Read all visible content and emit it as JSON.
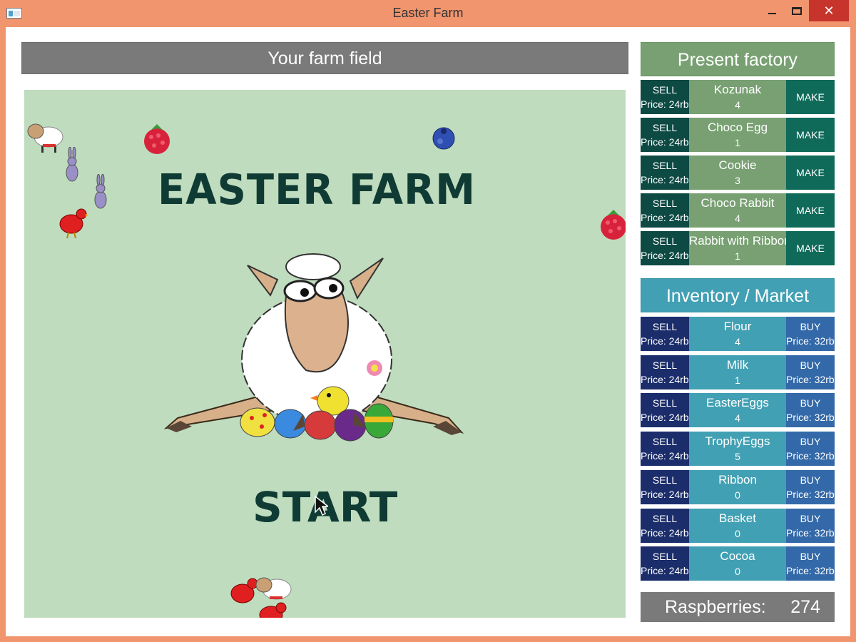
{
  "window": {
    "title": "Easter Farm",
    "close_glyph": "✕"
  },
  "field": {
    "header": "Your farm field",
    "game_title": "EASTER FARM",
    "start_label": "START"
  },
  "factory": {
    "header": "Present factory",
    "items": [
      {
        "sell": "SELL",
        "price": "Price: 24rb",
        "name": "Kozunak",
        "qty": "4",
        "action": "MAKE"
      },
      {
        "sell": "SELL",
        "price": "Price: 24rb",
        "name": "Choco Egg",
        "qty": "1",
        "action": "MAKE"
      },
      {
        "sell": "SELL",
        "price": "Price: 24rb",
        "name": "Cookie",
        "qty": "3",
        "action": "MAKE"
      },
      {
        "sell": "SELL",
        "price": "Price: 24rb",
        "name": "Choco Rabbit",
        "qty": "4",
        "action": "MAKE"
      },
      {
        "sell": "SELL",
        "price": "Price: 24rb",
        "name": "Rabbit with Ribbon",
        "qty": "1",
        "action": "MAKE"
      }
    ]
  },
  "market": {
    "header": "Inventory / Market",
    "items": [
      {
        "sell": "SELL",
        "sell_price": "Price: 24rb",
        "name": "Flour",
        "qty": "4",
        "buy": "BUY",
        "buy_price": "Price: 32rb"
      },
      {
        "sell": "SELL",
        "sell_price": "Price: 24rb",
        "name": "Milk",
        "qty": "1",
        "buy": "BUY",
        "buy_price": "Price: 32rb"
      },
      {
        "sell": "SELL",
        "sell_price": "Price: 24rb",
        "name": "EasterEggs",
        "qty": "4",
        "buy": "BUY",
        "buy_price": "Price: 32rb"
      },
      {
        "sell": "SELL",
        "sell_price": "Price: 24rb",
        "name": "TrophyEggs",
        "qty": "5",
        "buy": "BUY",
        "buy_price": "Price: 32rb"
      },
      {
        "sell": "SELL",
        "sell_price": "Price: 24rb",
        "name": "Ribbon",
        "qty": "0",
        "buy": "BUY",
        "buy_price": "Price: 32rb"
      },
      {
        "sell": "SELL",
        "sell_price": "Price: 24rb",
        "name": "Basket",
        "qty": "0",
        "buy": "BUY",
        "buy_price": "Price: 32rb"
      },
      {
        "sell": "SELL",
        "sell_price": "Price: 24rb",
        "name": "Cocoa",
        "qty": "0",
        "buy": "BUY",
        "buy_price": "Price: 32rb"
      }
    ]
  },
  "raspberries": {
    "label": "Raspberries:",
    "value": "274"
  },
  "colors": {
    "titlebar": "#f0956e",
    "field_bg": "#bfdcbe",
    "title_text": "#0f3b34",
    "factory_green": "#78a072",
    "market_teal": "#41a0b3",
    "close_red": "#c7342c"
  },
  "icons": [
    "app-icon",
    "minimize-icon",
    "maximize-icon",
    "close-icon",
    "sheep-icon",
    "rabbit-icon",
    "hen-icon",
    "raspberry-icon",
    "blueberry-icon",
    "mouse-cursor-icon"
  ]
}
